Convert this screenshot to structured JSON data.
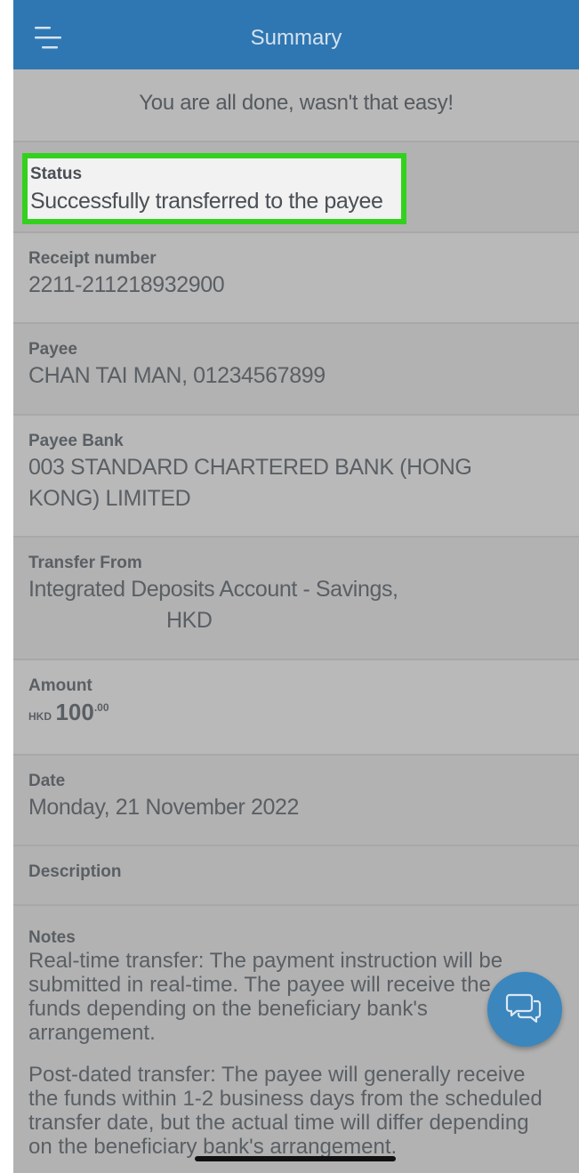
{
  "header": {
    "title": "Summary",
    "menu_icon": "menu-icon"
  },
  "banner": {
    "text": "You are all done, wasn't that easy!"
  },
  "status": {
    "label": "Status",
    "value": "Successfully transferred to the payee"
  },
  "receipt": {
    "label": "Receipt number",
    "value": "2211-211218932900"
  },
  "payee": {
    "label": "Payee",
    "value": "CHAN TAI MAN, 01234567899"
  },
  "payee_bank": {
    "label": "Payee Bank",
    "line1": "003 STANDARD CHARTERED BANK (HONG",
    "line2": "KONG) LIMITED"
  },
  "transfer_from": {
    "label": "Transfer From",
    "line1": "Integrated Deposits Account - Savings,",
    "line2": "HKD"
  },
  "amount": {
    "label": "Amount",
    "currency": "HKD",
    "integer": "100",
    "decimal": ".00"
  },
  "date": {
    "label": "Date",
    "value": "Monday, 21 November 2022"
  },
  "description": {
    "label": "Description"
  },
  "notes": {
    "label": "Notes",
    "paragraph1": "Real-time transfer: The payment instruction will be submitted in real-time. The payee will receive the funds depending on the beneficiary bank's arrangement.",
    "paragraph2": "Post-dated transfer: The payee will generally receive the funds within 1-2 business days from the scheduled transfer date, but the actual time will differ depending on the beneficiary bank's arrangement."
  },
  "chat": {
    "icon": "chat-bubbles-icon"
  },
  "colors": {
    "header": "#2f77b2",
    "highlight": "#33d11e",
    "chat": "#3b86bd"
  }
}
